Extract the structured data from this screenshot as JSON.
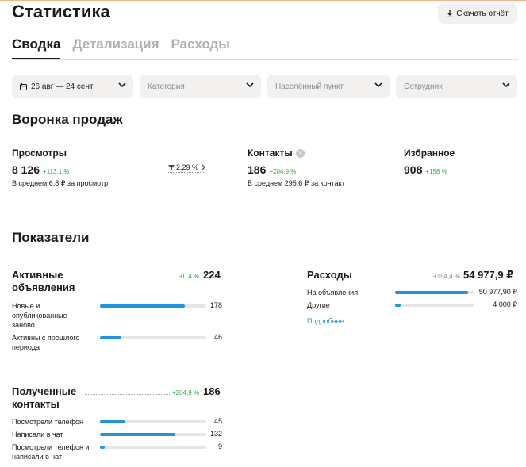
{
  "header": {
    "title": "Статистика",
    "download_label": "Скачать отчёт"
  },
  "tabs": [
    {
      "label": "Сводка",
      "active": true
    },
    {
      "label": "Детализация",
      "active": false
    },
    {
      "label": "Расходы",
      "active": false
    }
  ],
  "filters": {
    "date": "26 авг — 24 сент",
    "category_placeholder": "Категория",
    "city_placeholder": "Населённый пункт",
    "employee_placeholder": "Сотрудник"
  },
  "funnel": {
    "title": "Воронка продаж",
    "views": {
      "label": "Просмотры",
      "value": "8 126",
      "delta": "+113,1 %",
      "avg": "В среднем 6,8 ₽ за просмотр"
    },
    "conversion": "2,29 %",
    "contacts": {
      "label": "Контакты",
      "value": "186",
      "delta": "+204,9 %",
      "avg": "В среднем 295,6 ₽ за контакт"
    },
    "favorites": {
      "label": "Избранное",
      "value": "908",
      "delta": "+158 %"
    }
  },
  "indicators": {
    "title": "Показатели",
    "active": {
      "title": "Активные объявления",
      "delta": "+0,4 %",
      "total": "224",
      "rows": [
        {
          "label": "Новые и опубликованные заново",
          "value": "178",
          "share": 0.795
        },
        {
          "label": "Активны с прошлого периода",
          "value": "46",
          "share": 0.205
        }
      ]
    },
    "expenses": {
      "title": "Расходы",
      "delta": "+154,4 %",
      "total": "54 977,9 ₽",
      "rows": [
        {
          "label": "На объявления",
          "value": "50 977,90 ₽",
          "share": 0.927
        },
        {
          "label": "Другие",
          "value": "4 000 ₽",
          "share": 0.073
        }
      ],
      "more_link": "Подробнее"
    },
    "contacts": {
      "title": "Полученные контакты",
      "delta": "+204,9 %",
      "total": "186",
      "rows": [
        {
          "label": "Посмотрели телефон",
          "value": "45",
          "share": 0.242
        },
        {
          "label": "Написали в чат",
          "value": "132",
          "share": 0.71
        },
        {
          "label": "Посмотрели телефон и написали в чат",
          "value": "9",
          "share": 0.048
        }
      ]
    }
  },
  "colors": {
    "accent": "#1f93e0",
    "positive": "#2eaa4a",
    "track": "#e6e6e6"
  }
}
